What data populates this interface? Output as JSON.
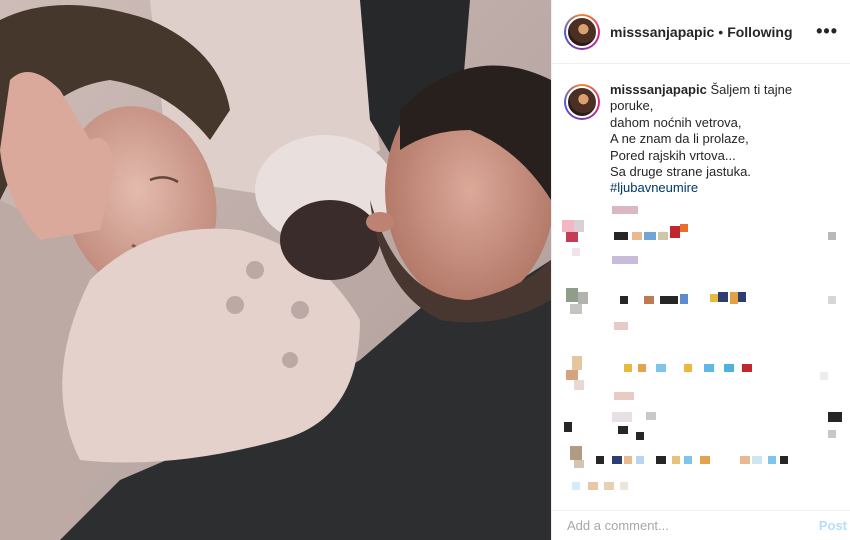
{
  "post": {
    "username": "misssanjapapic",
    "separator": "•",
    "follow_status": "Following",
    "more_icon": "•••"
  },
  "caption": {
    "username": "misssanjapapic",
    "lines": [
      "Šaljem ti tajne poruke,",
      "dahom noćnih vetrova,",
      "A ne znam da li prolaze,",
      "Pored rajskih vrtova...",
      "Sa druge strane jastuka."
    ],
    "hashtag": "#ljubavneumire"
  },
  "comment_box": {
    "placeholder": "Add a comment...",
    "post_label": "Post"
  },
  "photo": {
    "subject": "family-photo"
  }
}
